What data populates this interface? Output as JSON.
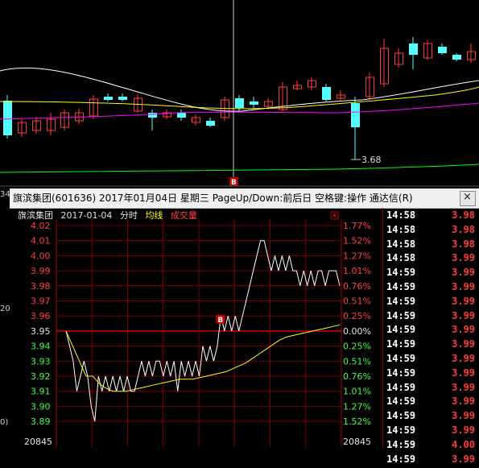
{
  "kline": {
    "min_price_label": "3.68",
    "marker_label": "B",
    "colors": {
      "up": "#ff3b3b",
      "down": "#54ffff",
      "ma5": "#ffffff",
      "ma10": "#ffff00",
      "ma20": "#ff00ff",
      "ma60": "#00ff00"
    }
  },
  "popup": {
    "title": "旗滨集团(601636) 2017年01月04日 星期三 PageUp/Down:前后日 空格键:操作 通达信(R)",
    "close_label": "×",
    "header": {
      "stock_name": "旗滨集团",
      "date": "2017-01-04",
      "mode": "分时",
      "avg_label": "均线",
      "vol_label": "成交量"
    },
    "left_stub": [
      "34",
      "20",
      "0)"
    ]
  },
  "chart_data": {
    "type": "line",
    "title": "",
    "prev_close": 3.95,
    "price_ticks": [
      "4.02",
      "4.01",
      "4.00",
      "3.99",
      "3.98",
      "3.97",
      "3.96",
      "3.95",
      "3.94",
      "3.93",
      "3.92",
      "3.91",
      "3.90",
      "3.89"
    ],
    "pct_ticks": [
      "1.77%",
      "1.52%",
      "1.27%",
      "1.01%",
      "0.76%",
      "0.51%",
      "0.25%",
      "0.00%",
      "0.25%",
      "0.51%",
      "0.76%",
      "1.01%",
      "1.27%",
      "1.52%"
    ],
    "volume_label_left": "20845",
    "volume_label_right": "20845",
    "buy_marker": "B",
    "series": [
      {
        "values": [
          3.95,
          3.94,
          3.93,
          3.91,
          3.92,
          3.93,
          3.92,
          3.9,
          3.89,
          3.92,
          3.91,
          3.92,
          3.91,
          3.92,
          3.91,
          3.92,
          3.91,
          3.92,
          3.91,
          3.91,
          3.92,
          3.93,
          3.92,
          3.93,
          3.92,
          3.93,
          3.93,
          3.92,
          3.93,
          3.92,
          3.93,
          3.91,
          3.93,
          3.92,
          3.93,
          3.92,
          3.93,
          3.92,
          3.94,
          3.93,
          3.94,
          3.93,
          3.94,
          3.96,
          3.95,
          3.96,
          3.95,
          3.96,
          3.95,
          3.96,
          3.97,
          3.98,
          3.99,
          4.0,
          4.01,
          4.01,
          4.0,
          3.99,
          4.0,
          3.99,
          4.0,
          3.99,
          4.0,
          3.99,
          3.99,
          3.98,
          3.99,
          3.98,
          3.99,
          3.98,
          3.99,
          3.99,
          3.98,
          3.99,
          3.99,
          3.99,
          3.98
        ]
      },
      {
        "values": [
          3.95,
          3.94,
          3.93,
          3.92,
          3.92,
          3.915,
          3.912,
          3.91,
          3.91,
          3.91,
          3.911,
          3.912,
          3.913,
          3.914,
          3.915,
          3.916,
          3.917,
          3.918,
          3.918,
          3.918,
          3.919,
          3.92,
          3.921,
          3.922,
          3.923,
          3.925,
          3.927,
          3.929,
          3.932,
          3.935,
          3.938,
          3.941,
          3.944,
          3.946,
          3.947,
          3.948,
          3.949,
          3.95,
          3.951,
          3.952,
          3.953,
          3.954
        ]
      }
    ]
  },
  "time_sales": [
    {
      "time": "14:58",
      "price": "3.98"
    },
    {
      "time": "14:58",
      "price": "3.98"
    },
    {
      "time": "14:58",
      "price": "3.98"
    },
    {
      "time": "14:58",
      "price": "3.99"
    },
    {
      "time": "14:59",
      "price": "3.99"
    },
    {
      "time": "14:59",
      "price": "3.99"
    },
    {
      "time": "14:59",
      "price": "3.99"
    },
    {
      "time": "14:59",
      "price": "3.99"
    },
    {
      "time": "14:59",
      "price": "3.99"
    },
    {
      "time": "14:59",
      "price": "3.99"
    },
    {
      "time": "14:59",
      "price": "3.99"
    },
    {
      "time": "14:59",
      "price": "3.99"
    },
    {
      "time": "14:59",
      "price": "3.99"
    },
    {
      "time": "14:59",
      "price": "3.99"
    },
    {
      "time": "14:59",
      "price": "3.99"
    },
    {
      "time": "14:59",
      "price": "3.99"
    },
    {
      "time": "14:59",
      "price": "4.00"
    },
    {
      "time": "14:59",
      "price": "3.99"
    }
  ]
}
